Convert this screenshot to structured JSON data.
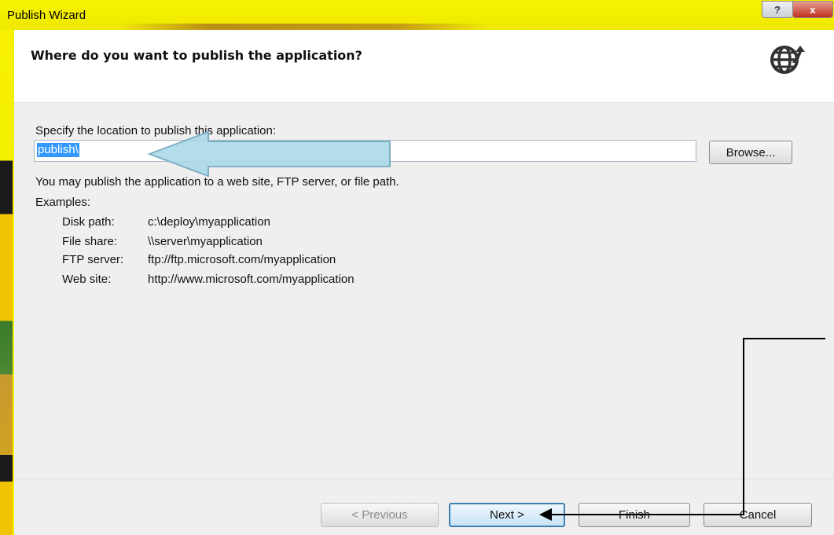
{
  "window": {
    "title": "Publish Wizard",
    "help_label": "?",
    "close_label": "x"
  },
  "header": {
    "title": "Where do you want to publish the application?",
    "icon": "globe-arrow-icon"
  },
  "form": {
    "location_label": "Specify the location to publish this application:",
    "location_value": "publish\\",
    "browse_label": "Browse...",
    "info_text": "You may publish the application to a web site, FTP server, or file path.",
    "examples_label": "Examples:",
    "examples": [
      {
        "key": "Disk path:",
        "value": "c:\\deploy\\myapplication"
      },
      {
        "key": "File share:",
        "value": "\\\\server\\myapplication"
      },
      {
        "key": "FTP server:",
        "value": "ftp://ftp.microsoft.com/myapplication"
      },
      {
        "key": "Web site:",
        "value": "http://www.microsoft.com/myapplication"
      }
    ]
  },
  "footer": {
    "previous_label": "< Previous",
    "next_label": "Next >",
    "finish_label": "Finish",
    "cancel_label": "Cancel"
  },
  "colors": {
    "highlight_bg": "#f4ef00",
    "selection": "#3399ff",
    "callout_arrow": "#a8d8e8"
  }
}
